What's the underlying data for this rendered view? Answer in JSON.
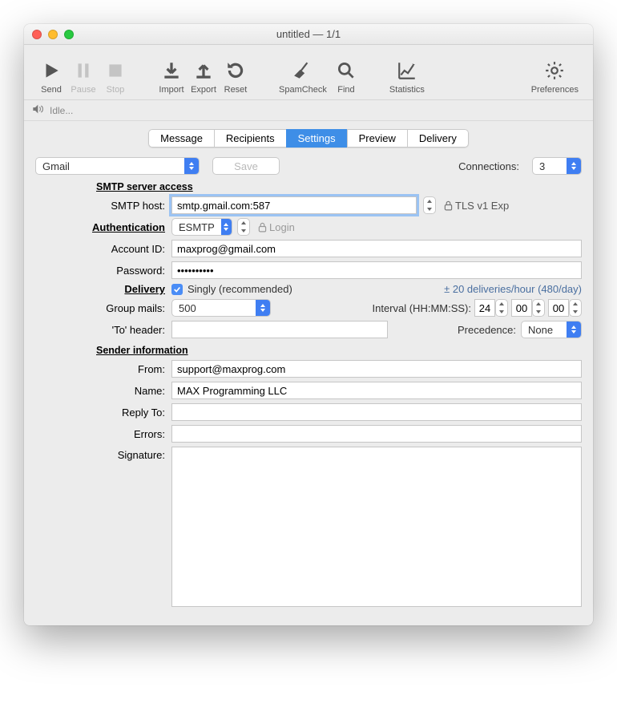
{
  "window": {
    "title": "untitled — 1/1"
  },
  "toolbar": {
    "send": "Send",
    "pause": "Pause",
    "stop": "Stop",
    "import": "Import",
    "export": "Export",
    "reset": "Reset",
    "spamcheck": "SpamCheck",
    "find": "Find",
    "statistics": "Statistics",
    "preferences": "Preferences"
  },
  "status": {
    "text": "Idle..."
  },
  "tabs": {
    "message": "Message",
    "recipients": "Recipients",
    "settings": "Settings",
    "preview": "Preview",
    "delivery": "Delivery"
  },
  "account_select": "Gmail",
  "save_btn": "Save",
  "connections_label": "Connections:",
  "connections_value": "3",
  "sections": {
    "smtp": "SMTP server access",
    "auth": "Authentication",
    "delivery": "Delivery",
    "sender": "Sender information"
  },
  "labels": {
    "smtp_host": "SMTP host:",
    "account_id": "Account ID:",
    "password": "Password:",
    "group_mails": "Group mails:",
    "to_header": "'To' header:",
    "from": "From:",
    "name": "Name:",
    "reply_to": "Reply To:",
    "errors": "Errors:",
    "signature": "Signature:",
    "interval": "Interval (HH:MM:SS):",
    "precedence": "Precedence:",
    "login_btn": "Login",
    "tls_text": "TLS v1 Exp"
  },
  "values": {
    "smtp_host": "smtp.gmail.com:587",
    "auth_mode": "ESMTP",
    "account_id": "maxprog@gmail.com",
    "password": "••••••••••",
    "singly": "Singly (recommended)",
    "rate": "± 20 deliveries/hour (480/day)",
    "group_mails": "500",
    "interval_hh": "24",
    "interval_mm": "00",
    "interval_ss": "00",
    "precedence": "None",
    "from": "support@maxprog.com",
    "name": "MAX Programming LLC",
    "reply_to": "",
    "errors": "",
    "signature": "",
    "to_header": ""
  }
}
